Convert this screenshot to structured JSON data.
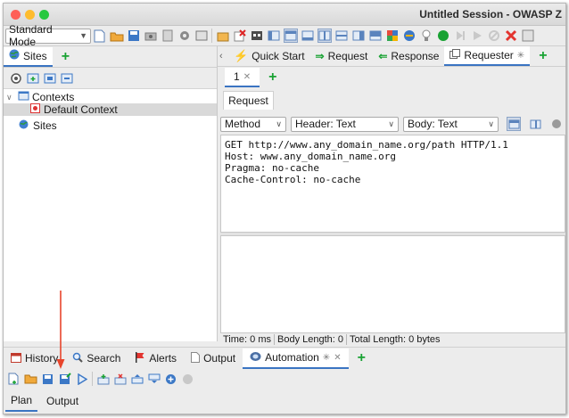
{
  "window": {
    "title": "Untitled Session - OWASP Z",
    "lights": {
      "close": "#fe5f57",
      "minimize": "#febc2e",
      "zoom": "#28c840"
    }
  },
  "toolbar": {
    "mode_select": "Standard Mode"
  },
  "left_pane": {
    "sites_tab": "Sites",
    "tree": {
      "contexts": "Contexts",
      "default_context": "Default Context",
      "sites": "Sites"
    }
  },
  "right_pane": {
    "tabs": {
      "quick_start": "Quick Start",
      "request": "Request",
      "response": "Response",
      "requester": "Requester"
    },
    "number_tab": "1",
    "inner_tab": "Request",
    "options": {
      "method": "Method",
      "header": "Header: Text",
      "body": "Body: Text"
    },
    "request_lines": [
      "GET http://www.any_domain_name.org/path HTTP/1.1",
      "Host: www.any_domain_name.org",
      "Pragma: no-cache",
      "Cache-Control: no-cache"
    ],
    "status": {
      "time": "Time: 0 ms",
      "body_length": "Body Length: 0",
      "total_length": "Total Length: 0 bytes"
    }
  },
  "bottom_tabs": {
    "history": "History",
    "search": "Search",
    "alerts": "Alerts",
    "output": "Output",
    "automation": "Automation"
  },
  "automation_tabs": {
    "plan": "Plan",
    "output": "Output"
  },
  "colors": {
    "accent": "#3a74c2",
    "add_green": "#19a233",
    "annotation_arrow": "#e8452c"
  }
}
